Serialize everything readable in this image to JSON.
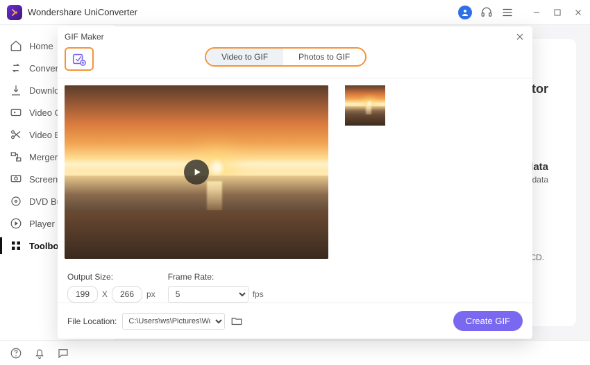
{
  "app": {
    "title": "Wondershare UniConverter"
  },
  "window_controls": {
    "minimize": "minimize",
    "maximize": "maximize",
    "close": "close"
  },
  "sidebar": {
    "items": [
      {
        "label": "Home",
        "icon": "home-icon"
      },
      {
        "label": "Converter",
        "icon": "converter-icon"
      },
      {
        "label": "Downloader",
        "icon": "download-icon"
      },
      {
        "label": "Video Compressor",
        "icon": "compress-icon"
      },
      {
        "label": "Video Editor",
        "icon": "scissors-icon"
      },
      {
        "label": "Merger",
        "icon": "merger-icon"
      },
      {
        "label": "Screen Recorder",
        "icon": "record-icon"
      },
      {
        "label": "DVD Burner",
        "icon": "disc-icon"
      },
      {
        "label": "Player",
        "icon": "player-icon"
      },
      {
        "label": "Toolbox",
        "icon": "grid-icon"
      }
    ],
    "active_index": 9
  },
  "background_card": {
    "frag_tor": "tor",
    "frag_data": "data",
    "frag_metadata": "etadata",
    "frag_cd": "CD."
  },
  "modal": {
    "title": "GIF Maker",
    "tabs": {
      "video": "Video to GIF",
      "photos": "Photos to GIF",
      "active": "video"
    },
    "output_size": {
      "label": "Output Size:",
      "width": "199",
      "height": "266",
      "x": "X",
      "unit": "px"
    },
    "frame_rate": {
      "label": "Frame Rate:",
      "value": "5",
      "unit": "fps"
    },
    "file_location": {
      "label": "File Location:",
      "path": "C:\\Users\\ws\\Pictures\\Wonders"
    },
    "create_button": "Create GIF"
  },
  "statusbar": {
    "help": "help",
    "notify": "notify",
    "feedback": "feedback"
  }
}
